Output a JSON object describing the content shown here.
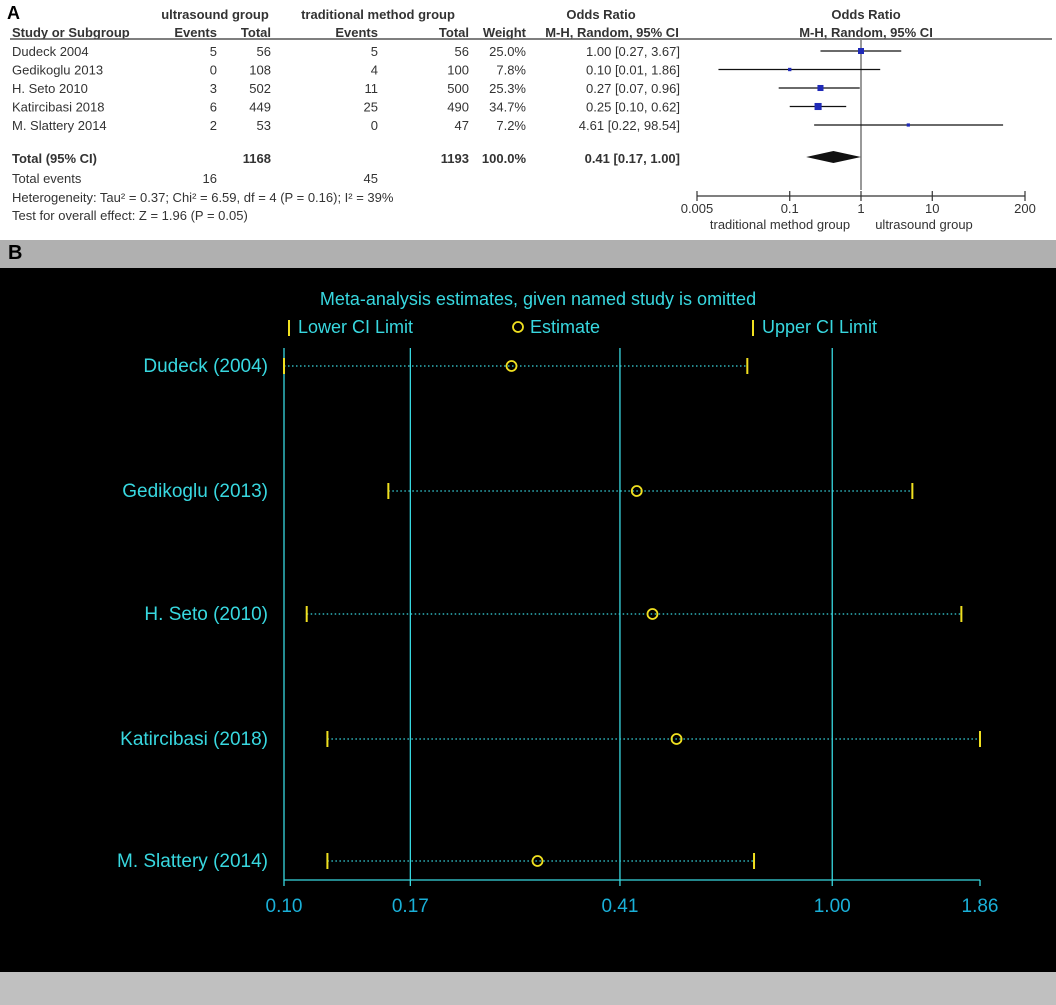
{
  "panel_a": {
    "label": "A",
    "group_headers": {
      "exp": "ultrasound group",
      "ctrl": "traditional method group",
      "or_table": "Odds Ratio",
      "or_plot": "Odds Ratio"
    },
    "columns": [
      "Study or Subgroup",
      "Events",
      "Total",
      "Events",
      "Total",
      "Weight",
      "M-H, Random, 95% CI",
      "M-H, Random, 95% CI"
    ],
    "studies": [
      {
        "name": "Dudeck 2004",
        "e1": "5",
        "t1": "56",
        "e2": "5",
        "t2": "56",
        "weight": "25.0%",
        "ci": "1.00 [0.27, 3.67]"
      },
      {
        "name": "Gedikoglu 2013",
        "e1": "0",
        "t1": "108",
        "e2": "4",
        "t2": "100",
        "weight": "7.8%",
        "ci": "0.10 [0.01, 1.86]"
      },
      {
        "name": "H. Seto 2010",
        "e1": "3",
        "t1": "502",
        "e2": "11",
        "t2": "500",
        "weight": "25.3%",
        "ci": "0.27 [0.07, 0.96]"
      },
      {
        "name": "Katircibasi 2018",
        "e1": "6",
        "t1": "449",
        "e2": "25",
        "t2": "490",
        "weight": "34.7%",
        "ci": "0.25 [0.10, 0.62]"
      },
      {
        "name": "M. Slattery 2014",
        "e1": "2",
        "t1": "53",
        "e2": "0",
        "t2": "47",
        "weight": "7.2%",
        "ci": "4.61 [0.22, 98.54]"
      }
    ],
    "total": {
      "name": "Total (95% CI)",
      "t1": "1168",
      "t2": "1193",
      "weight": "100.0%",
      "ci": "0.41 [0.17, 1.00]"
    },
    "total_events": {
      "name": "Total events",
      "e1": "16",
      "e2": "45"
    },
    "heterogeneity": "Heterogeneity: Tau² = 0.37; Chi² = 6.59, df = 4 (P = 0.16); I² = 39%",
    "overall_effect": "Test for overall effect: Z = 1.96 (P = 0.05)",
    "axis_ticks": [
      "0.005",
      "0.1",
      "1",
      "10",
      "200"
    ],
    "favours_left": "traditional method group",
    "favours_right": "ultrasound group"
  },
  "panel_b": {
    "label": "B",
    "title": "Meta-analysis estimates, given named study is omitted",
    "legend": {
      "lower": "Lower CI Limit",
      "estimate": "Estimate",
      "upper": "Upper CI Limit"
    },
    "tick_labels": [
      "0.10",
      "0.17",
      "0.41",
      "1.00",
      "1.86"
    ]
  },
  "chart_data": [
    {
      "type": "scatter",
      "subtype": "forest-plot",
      "title": "Odds Ratio",
      "xlabel": "M-H, Random, 95% CI",
      "x_scale": "log",
      "xlim": [
        0.005,
        200
      ],
      "reference_line": 1,
      "series": [
        {
          "name": "Dudeck 2004",
          "estimate": 1.0,
          "lower": 0.27,
          "upper": 3.67,
          "weight": 25.0
        },
        {
          "name": "Gedikoglu 2013",
          "estimate": 0.1,
          "lower": 0.01,
          "upper": 1.86,
          "weight": 7.8
        },
        {
          "name": "H. Seto 2010",
          "estimate": 0.27,
          "lower": 0.07,
          "upper": 0.96,
          "weight": 25.3
        },
        {
          "name": "Katircibasi 2018",
          "estimate": 0.25,
          "lower": 0.1,
          "upper": 0.62,
          "weight": 34.7
        },
        {
          "name": "M. Slattery 2014",
          "estimate": 4.61,
          "lower": 0.22,
          "upper": 98.54,
          "weight": 7.2
        }
      ],
      "pooled": {
        "estimate": 0.41,
        "lower": 0.17,
        "upper": 1.0
      }
    },
    {
      "type": "scatter",
      "subtype": "sensitivity-analysis",
      "title": "Meta-analysis estimates, given named study is omitted",
      "x_scale": "log",
      "xlim": [
        0.1,
        1.86
      ],
      "reference_lines": [
        0.17,
        0.41,
        1.0
      ],
      "series": [
        {
          "name": "Dudeck (2004)",
          "lower": 0.1,
          "estimate": 0.26,
          "upper": 0.7
        },
        {
          "name": "Gedikoglu (2013)",
          "lower": 0.155,
          "estimate": 0.44,
          "upper": 1.4
        },
        {
          "name": "H. Seto (2010)",
          "lower": 0.11,
          "estimate": 0.47,
          "upper": 1.72
        },
        {
          "name": "Katircibasi (2018)",
          "lower": 0.12,
          "estimate": 0.52,
          "upper": 1.86
        },
        {
          "name": "M. Slattery (2014)",
          "lower": 0.12,
          "estimate": 0.29,
          "upper": 0.72
        }
      ]
    }
  ]
}
